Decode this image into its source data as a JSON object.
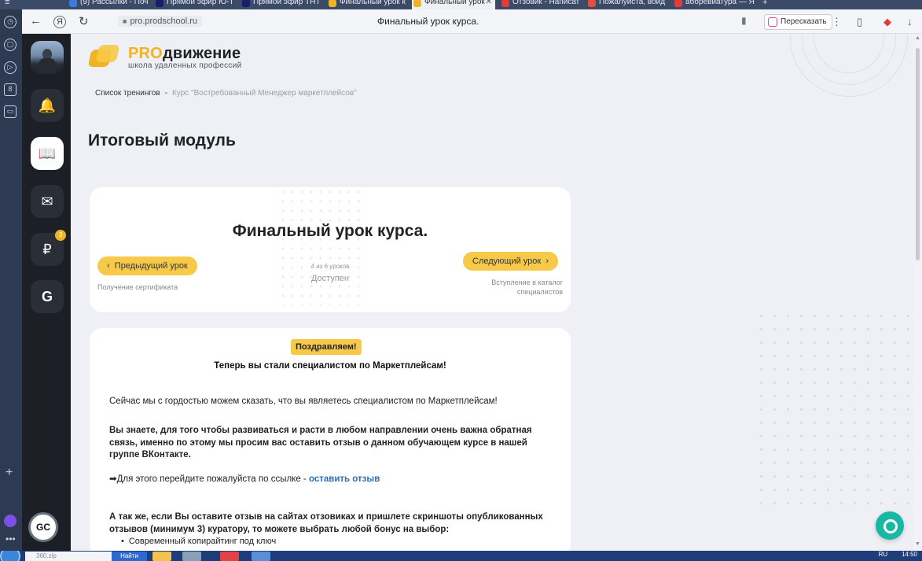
{
  "browser": {
    "tabs": [
      {
        "label": "(9) Рассылки - Поч",
        "color": "#3b7be0"
      },
      {
        "label": "Прямой эфир Ю-Т",
        "color": "#1b1b6b"
      },
      {
        "label": "Прямой эфир ТНТ",
        "color": "#1b1b6b"
      },
      {
        "label": "Финальный урок к",
        "color": "#f0b323"
      },
      {
        "label": "Финальный урок",
        "color": "#f0b323",
        "active": true
      },
      {
        "label": "Отзовик - Написат",
        "color": "#e23b3b"
      },
      {
        "label": "Пожалуйста, войд",
        "color": "#e2503b"
      },
      {
        "label": "аббревиатура — Я",
        "color": "#e23b3b"
      }
    ],
    "url": "pro.prodschool.ru",
    "page_title": "Финальный урок курса.",
    "retell_label": "Пересказать",
    "nav": {
      "back": "←",
      "yandex": "Я",
      "reload": "↻",
      "close_tab": "✕",
      "new_tab": "+"
    }
  },
  "left_strip": {
    "icons": [
      "◷",
      "▢",
      "▷",
      "8",
      "▭"
    ],
    "plus": "+",
    "dots": "•••"
  },
  "site_sidebar": {
    "buttons": [
      {
        "name": "bell",
        "glyph": "🔔"
      },
      {
        "name": "book",
        "glyph": "📖"
      },
      {
        "name": "mail",
        "glyph": "✉"
      },
      {
        "name": "ruble",
        "glyph": "₽"
      },
      {
        "name": "getcourse",
        "glyph": "G"
      }
    ],
    "badge_count": "3",
    "gc_logo": "GC"
  },
  "logo": {
    "brand_pro": "PRO",
    "brand_rest": "движение",
    "tagline": "школа удаленных профессий"
  },
  "breadcrumb": {
    "root": "Список тренингов",
    "separator": "-",
    "current": "Курс \"Востребованный Менеджер маркетплейсов\""
  },
  "module_title": "Итоговый модуль",
  "lesson": {
    "title": "Финальный урок курса.",
    "prev_label": "Предыдущий урок",
    "prev_sub": "Получение сертификата",
    "next_label": "Следующий урок",
    "next_sub_line1": "Вступление в каталог",
    "next_sub_line2": "специалистов",
    "progress": "4 из 6 уроков",
    "status": "Доступен"
  },
  "content": {
    "congrats": "Поздравляем!",
    "heading": "Теперь вы стали специалистом по Маркетплейсам!",
    "p1": "Сейчас мы с гордостью можем сказать, что вы являетесь специалистом по Маркетплейсам!",
    "p2": "Вы знаете, для того чтобы развиваться и расти в любом направлении очень важна обратная связь, именно по этому мы просим вас оставить отзыв о данном обучающем курсе в нашей группе ВКонтакте.",
    "p3_text": "➡Для этого перейдите пожалуйста по ссылке - ",
    "p3_link": "оставить отзыв",
    "p4": "А так же, если Вы оставите отзыв на сайтах отзовиках и пришлете скриншоты опубликованных отзывов (минимум 3) куратору, то можете выбрать любой бонус на выбор:",
    "bullet1": "Современный копирайтинг под ключ"
  },
  "taskbar": {
    "search_placeholder": "360.zip",
    "find_label": "Найти",
    "lang": "RU",
    "time": "14:50"
  }
}
